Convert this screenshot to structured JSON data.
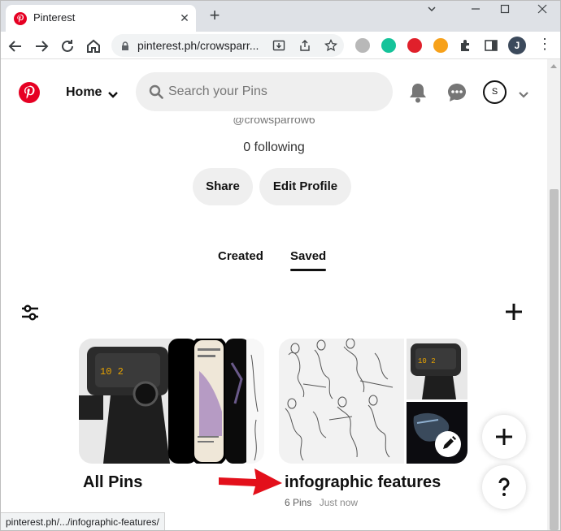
{
  "browser": {
    "tab_title": "Pinterest",
    "url": "pinterest.ph/crowsparr...",
    "status_url": "pinterest.ph/.../infographic-features/",
    "profile_initial": "J"
  },
  "header": {
    "home_label": "Home",
    "search_placeholder": "Search your Pins",
    "account_initial": "S"
  },
  "profile": {
    "username": "@crowsparrow6",
    "following": "0 following",
    "share_label": "Share",
    "edit_label": "Edit Profile"
  },
  "tabs": {
    "created": "Created",
    "saved": "Saved"
  },
  "boards": [
    {
      "title": "All Pins"
    },
    {
      "title": "infographic features",
      "pins": "6 Pins",
      "updated": "Just now"
    }
  ],
  "colors": {
    "brand": "#e60023",
    "arrow": "#e3101b",
    "pill_bg": "#efefef"
  }
}
